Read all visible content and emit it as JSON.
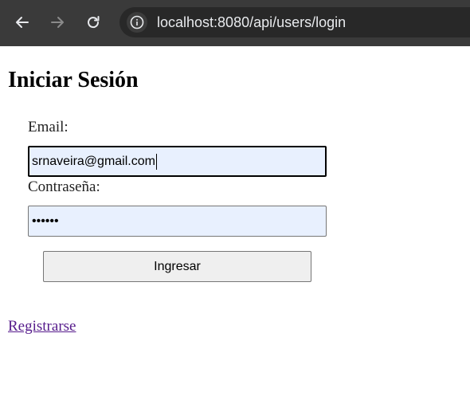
{
  "browser": {
    "url": "localhost:8080/api/users/login",
    "icons": {
      "back": "arrow-left-icon",
      "forward": "arrow-right-icon",
      "reload": "reload-icon",
      "site_info": "info-icon"
    },
    "colors": {
      "toolbar": "#3a3a3a",
      "omnibox": "#282828",
      "url_text": "#e8eaed"
    }
  },
  "login": {
    "title": "Iniciar Sesión",
    "email_label": "Email:",
    "email_value": "srnaveira@gmail.com",
    "password_label": "Contraseña:",
    "password_value": "••••••",
    "submit_label": "Ingresar"
  },
  "links": {
    "register": "Registrarse"
  },
  "colors": {
    "autofill_background": "#e8f0fe",
    "visited_link": "#551a8b"
  }
}
